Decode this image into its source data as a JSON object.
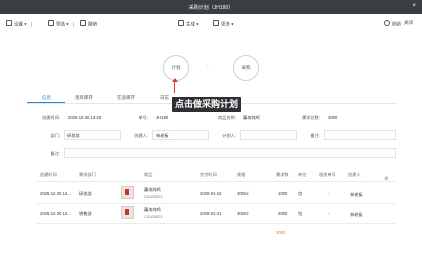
{
  "window": {
    "title": "采购计划（JH180）",
    "close": "×"
  },
  "toolbar": {
    "left": [
      {
        "label": "设置",
        "arrow": "▾"
      },
      {
        "label": "筛选",
        "arrow": "▾"
      },
      {
        "label": "撤销",
        "arrow": ""
      }
    ],
    "center": [
      {
        "label": "生成",
        "arrow": "▾"
      },
      {
        "label": "更多",
        "arrow": "▾"
      }
    ],
    "right": [
      {
        "label": "刷新"
      },
      {
        "label": "关闭"
      }
    ]
  },
  "flow": {
    "step1": "计划",
    "arrow": "›",
    "step2": "采购"
  },
  "callout": "点击做采购计划",
  "tabs": [
    "信息",
    "现有库存",
    "在途库存",
    "日志"
  ],
  "form": {
    "created_label": "创建时间:",
    "created_value": "2025-12-30 13:29",
    "doc_label": "单号:",
    "doc_value": "JH180",
    "product_label": "商品名称:",
    "product_value": "藕块炖鸡",
    "qty_label": "需求总数:",
    "qty_value": "3000",
    "dept_label": "部门:",
    "dept_value": "研发部",
    "creator_label": "创建人:",
    "creator_value": "林老板",
    "planner_label": "计划人:",
    "planner_value": "",
    "remark_label": "备注:",
    "remark_value": "",
    "note_label": "备注:",
    "note_value": ""
  },
  "table": {
    "headers": [
      "创建时间",
      "需求部门",
      "商品",
      "交付时间",
      "规格",
      "需求数",
      "单位",
      "相关单号",
      "创建人"
    ],
    "rows": [
      {
        "created": "2025-12-30 13...",
        "dept": "研发部",
        "product": "藕块炖鸡",
        "code": "C3100023",
        "date": "2026-01-15",
        "spec": "300ml",
        "qty": "1000",
        "unit": "包",
        "ref": "-",
        "creator": "林老板"
      },
      {
        "created": "2025-12-30 13...",
        "dept": "销售部",
        "product": "藕块炖鸡",
        "code": "C3100023",
        "date": "2026-01-31",
        "spec": "300ml",
        "qty": "2000",
        "unit": "包",
        "ref": "-",
        "creator": "林老板"
      }
    ],
    "total": "3000",
    "settings_icon": "⚙"
  }
}
